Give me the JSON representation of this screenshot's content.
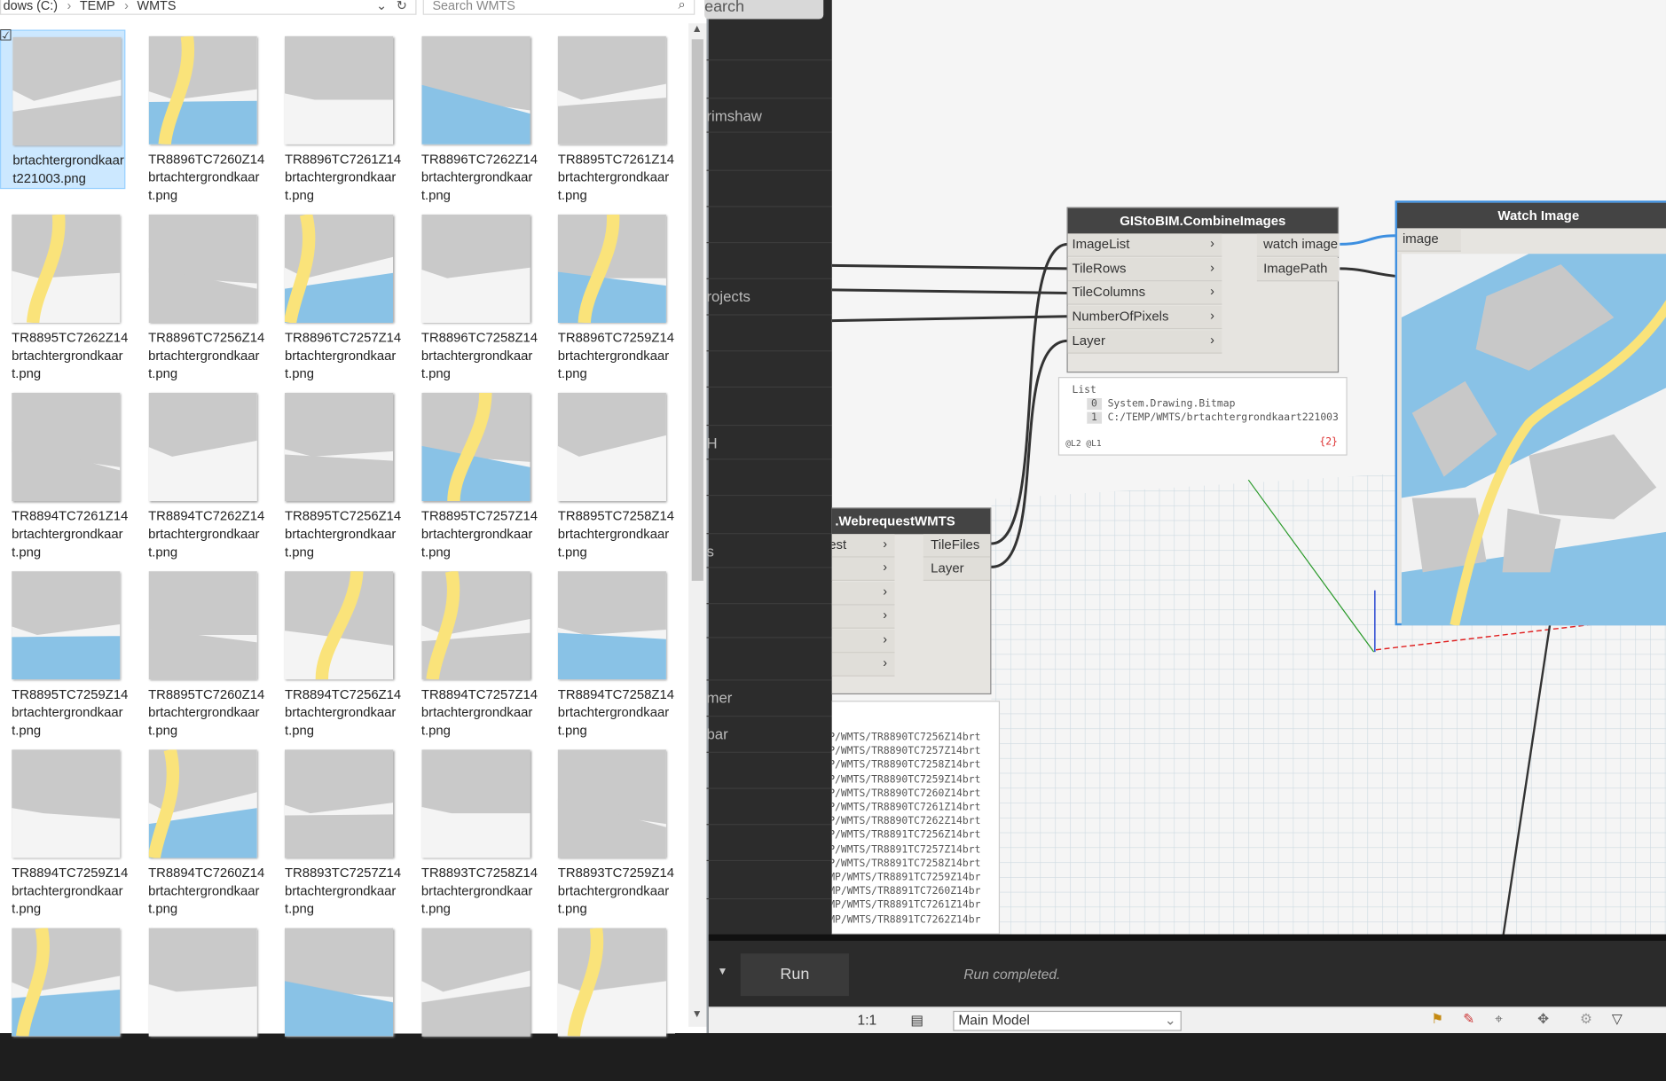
{
  "explorer": {
    "address": [
      "dows (C:)",
      "TEMP",
      "WMTS"
    ],
    "search_placeholder": "Search WMTS",
    "files": [
      {
        "name": "brtachtergrondkaar\nt221003.png",
        "selected": true
      },
      {
        "name": "TR8896TC7260Z14\nbrtachtergrondkaar\nt.png"
      },
      {
        "name": "TR8896TC7261Z14\nbrtachtergrondkaar\nt.png"
      },
      {
        "name": "TR8896TC7262Z14\nbrtachtergrondkaar\nt.png"
      },
      {
        "name": "TR8895TC7261Z14\nbrtachtergrondkaar\nt.png"
      },
      {
        "name": "TR8895TC7262Z14\nbrtachtergrondkaar\nt.png"
      },
      {
        "name": "TR8896TC7256Z14\nbrtachtergrondkaar\nt.png"
      },
      {
        "name": "TR8896TC7257Z14\nbrtachtergrondkaar\nt.png"
      },
      {
        "name": "TR8896TC7258Z14\nbrtachtergrondkaar\nt.png"
      },
      {
        "name": "TR8896TC7259Z14\nbrtachtergrondkaar\nt.png"
      },
      {
        "name": "TR8894TC7261Z14\nbrtachtergrondkaar\nt.png"
      },
      {
        "name": "TR8894TC7262Z14\nbrtachtergrondkaar\nt.png"
      },
      {
        "name": "TR8895TC7256Z14\nbrtachtergrondkaar\nt.png"
      },
      {
        "name": "TR8895TC7257Z14\nbrtachtergrondkaar\nt.png"
      },
      {
        "name": "TR8895TC7258Z14\nbrtachtergrondkaar\nt.png"
      },
      {
        "name": "TR8895TC7259Z14\nbrtachtergrondkaar\nt.png"
      },
      {
        "name": "TR8895TC7260Z14\nbrtachtergrondkaar\nt.png"
      },
      {
        "name": "TR8894TC7256Z14\nbrtachtergrondkaar\nt.png"
      },
      {
        "name": "TR8894TC7257Z14\nbrtachtergrondkaar\nt.png"
      },
      {
        "name": "TR8894TC7258Z14\nbrtachtergrondkaar\nt.png"
      },
      {
        "name": "TR8894TC7259Z14\nbrtachtergrondkaar\nt.png"
      },
      {
        "name": "TR8894TC7260Z14\nbrtachtergrondkaar\nt.png"
      },
      {
        "name": "TR8893TC7257Z14\nbrtachtergrondkaar\nt.png"
      },
      {
        "name": "TR8893TC7258Z14\nbrtachtergrondkaar\nt.png"
      },
      {
        "name": "TR8893TC7259Z14\nbrtachtergrondkaar\nt.png"
      },
      {
        "name": ""
      },
      {
        "name": ""
      },
      {
        "name": ""
      },
      {
        "name": ""
      },
      {
        "name": ""
      }
    ]
  },
  "library": {
    "search": "earch",
    "items": [
      "rimshaw",
      "rojects",
      "H",
      "s",
      "",
      "mer",
      "bar"
    ]
  },
  "nodes": {
    "combine": {
      "title": "GIStoBIM.CombineImages",
      "inputs": [
        "ImageList",
        "TileRows",
        "TileColumns",
        "NumberOfPixels",
        "Layer"
      ],
      "outputs": [
        "watch image",
        "ImagePath"
      ]
    },
    "combine_out": {
      "title": "List",
      "rows": [
        {
          "i": "0",
          "v": "System.Drawing.Bitmap"
        },
        {
          "i": "1",
          "v": "C:/TEMP/WMTS/brtachtergrondkaart221003"
        }
      ],
      "levels": "@L2 @L1",
      "count": "{2}"
    },
    "watch": {
      "title": "Watch Image",
      "input": "image"
    },
    "webreq": {
      "title": ".WebrequestWMTS",
      "input0": "est",
      "outputs": [
        "TileFiles",
        "Layer"
      ]
    },
    "webreq_out": {
      "rows": [
        "P/WMTS/TR8890TC7256Z14brt",
        "P/WMTS/TR8890TC7257Z14brt",
        "P/WMTS/TR8890TC7258Z14brt",
        "P/WMTS/TR8890TC7259Z14brt",
        "P/WMTS/TR8890TC7260Z14brt",
        "P/WMTS/TR8890TC7261Z14brt",
        "P/WMTS/TR8890TC7262Z14brt",
        "P/WMTS/TR8891TC7256Z14brt",
        "P/WMTS/TR8891TC7257Z14brt",
        "P/WMTS/TR8891TC7258Z14brt",
        "MP/WMTS/TR8891TC7259Z14br",
        "MP/WMTS/TR8891TC7260Z14br",
        "MP/WMTS/TR8891TC7261Z14br",
        "MP/WMTS/TR8891TC7262Z14br"
      ]
    }
  },
  "run": {
    "label": "Run",
    "status": "Run completed."
  },
  "bottom": {
    "view": "Main Model",
    "scale": "1:1"
  }
}
